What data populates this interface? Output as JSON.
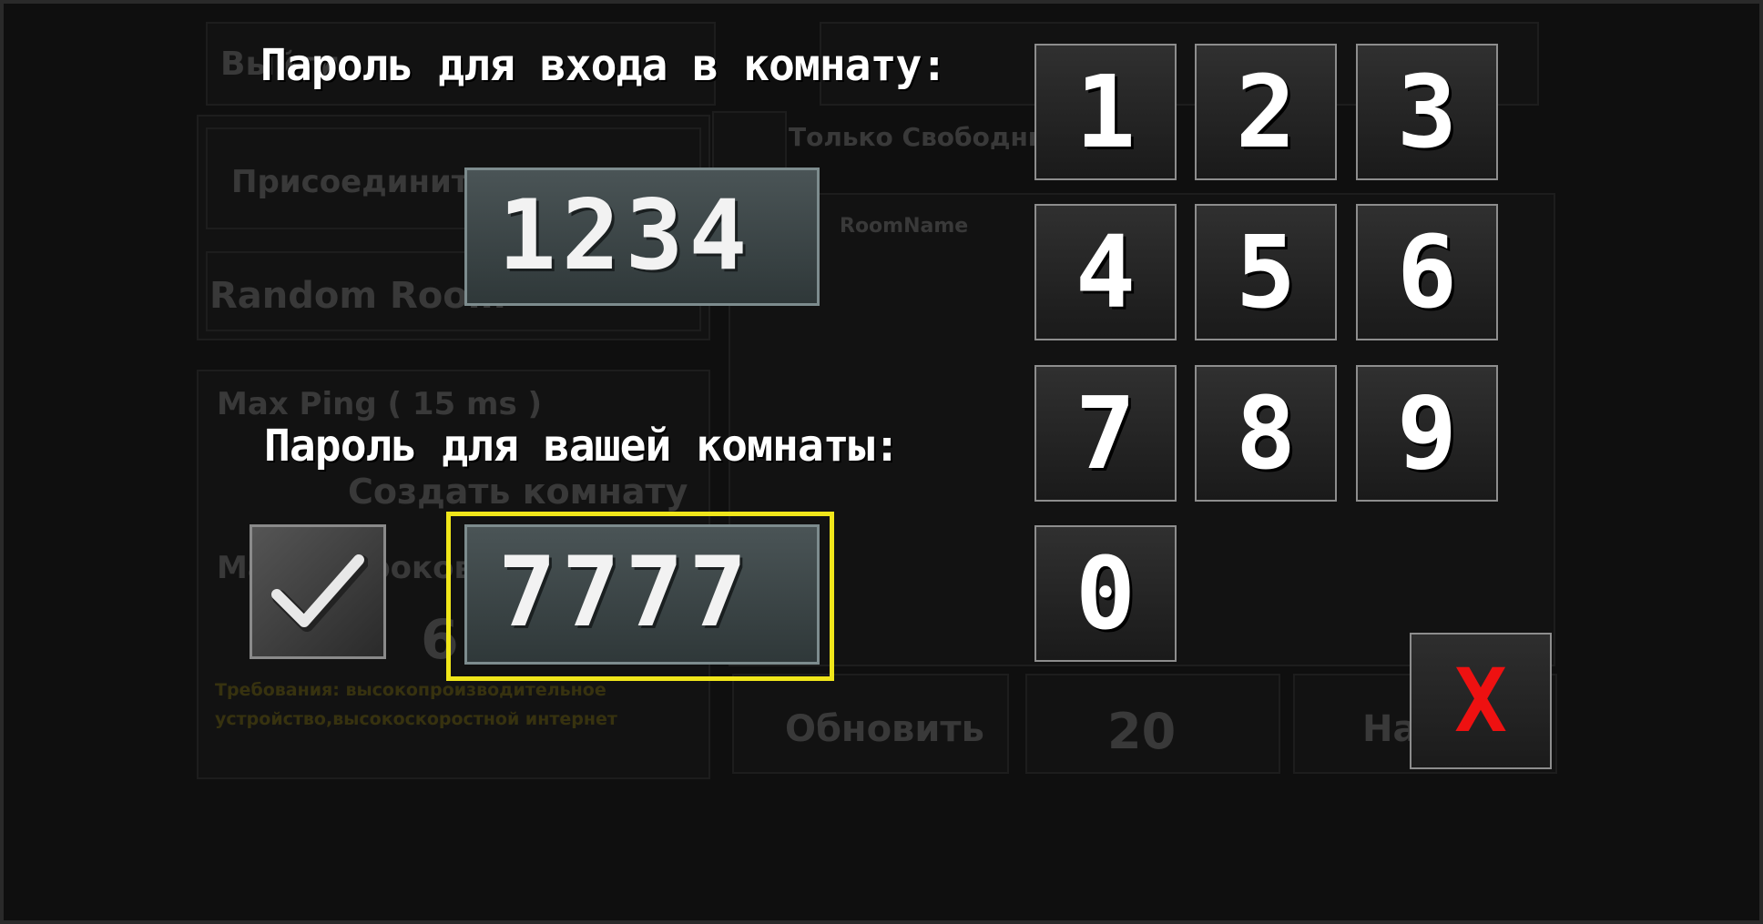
{
  "background": {
    "top_button": "Выйти",
    "join_button": "Присоединиться",
    "random_room": "Random Room",
    "only_free": "Только Свободные",
    "room_name_header": "RoomName",
    "max_ping": "Max Ping ( 15 ms )",
    "create_room": "Создать комнату",
    "max_players": "Макс. игроков",
    "max_players_value": "6",
    "requirements": "Требования: высокопроизводительное устройство,высокоскоростной интернет",
    "refresh_button": "Обновить",
    "page_count": "20",
    "right_button": "На"
  },
  "dialog": {
    "join_password_label": "Пароль для входа в комнату:",
    "join_password_value": "1234",
    "own_password_label": "Пароль для вашей комнаты:",
    "own_password_value": "7777",
    "own_password_enabled": true,
    "keys": [
      "1",
      "2",
      "3",
      "4",
      "5",
      "6",
      "7",
      "8",
      "9",
      "0"
    ],
    "close_label": "X"
  },
  "colors": {
    "highlight": "#f0e61a",
    "close": "#ee1111"
  }
}
